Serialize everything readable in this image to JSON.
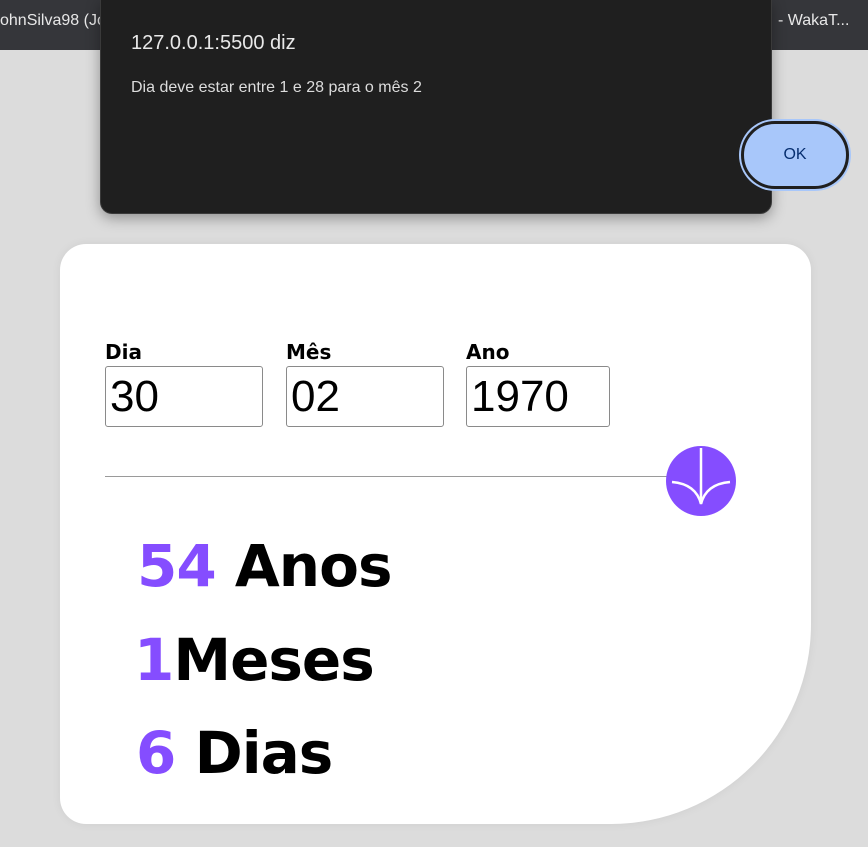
{
  "browser": {
    "tab_left": "ohnSilva98 (Jo",
    "tab_right": "- WakaT..."
  },
  "alert": {
    "title": "127.0.0.1:5500 diz",
    "message": "Dia deve estar entre 1 e 28 para o mês 2",
    "ok_label": "OK"
  },
  "form": {
    "day_label": "Dia",
    "day_value": "30",
    "month_label": "Mês",
    "month_value": "02",
    "year_label": "Ano",
    "year_value": "1970"
  },
  "results": {
    "years_value": "54",
    "years_unit": "Anos",
    "months_value": "1",
    "months_unit": "Meses",
    "days_value": "6",
    "days_unit": "Dias"
  },
  "colors": {
    "accent": "#854dff",
    "dialog_bg": "#1f1f1f",
    "ok_button": "#a8c7fa",
    "page_bg": "#dcdcdc"
  },
  "icons": {
    "submit": "arrow-down-icon"
  }
}
